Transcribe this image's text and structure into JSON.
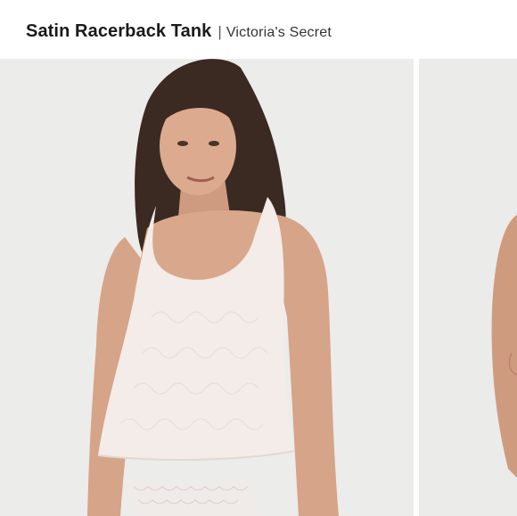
{
  "header": {
    "product_name": "Satin Racerback Tank",
    "separator": "|",
    "brand": "Victoria's Secret"
  },
  "gallery": {
    "images": [
      {
        "description_icon": "model-front-photo",
        "active": true
      },
      {
        "description_icon": "model-side-photo",
        "active": false
      }
    ]
  },
  "colors": {
    "background": "#ffffff",
    "photo_background": "#ececea",
    "garment": "#f3ece8",
    "skin": "#d9a88c",
    "hair": "#3b2a22"
  }
}
